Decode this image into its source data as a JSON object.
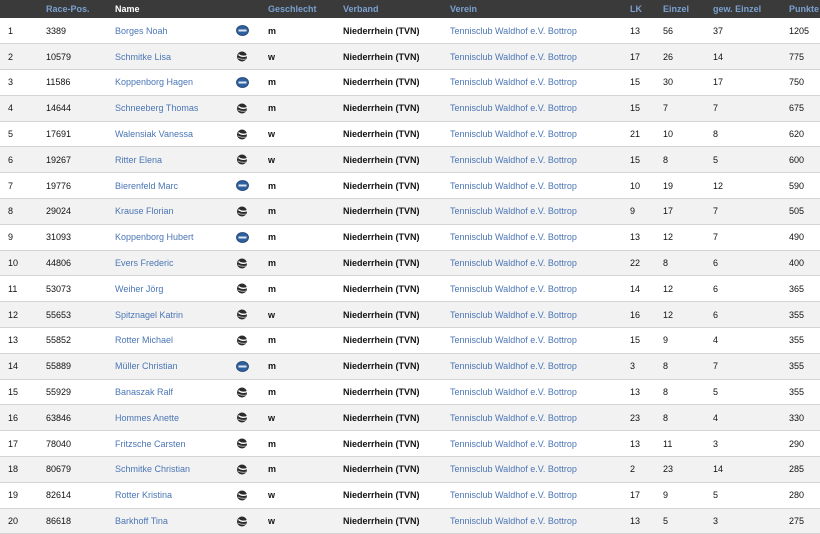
{
  "headers": {
    "no": "",
    "race_pos": "Race-Pos.",
    "name": "Name",
    "icon": "",
    "geschlecht": "Geschlecht",
    "verband": "Verband",
    "verein": "Verein",
    "lk": "LK",
    "einzel": "Einzel",
    "gew_einzel": "gew. Einzel",
    "punkte": "Punkte"
  },
  "rows": [
    {
      "no": "1",
      "race": "3389",
      "name": "Borges Noah",
      "icon": "badge-icon",
      "sex": "m",
      "verband": "Niederrhein (TVN)",
      "verein": "Tennisclub Waldhof e.V. Bottrop",
      "lk": "13",
      "einzel": "56",
      "gew": "37",
      "punkte": "1205"
    },
    {
      "no": "2",
      "race": "10579",
      "name": "Schmitke Lisa",
      "icon": "ball-icon",
      "sex": "w",
      "verband": "Niederrhein (TVN)",
      "verein": "Tennisclub Waldhof e.V. Bottrop",
      "lk": "17",
      "einzel": "26",
      "gew": "14",
      "punkte": "775"
    },
    {
      "no": "3",
      "race": "11586",
      "name": "Koppenborg Hagen",
      "icon": "badge-icon",
      "sex": "m",
      "verband": "Niederrhein (TVN)",
      "verein": "Tennisclub Waldhof e.V. Bottrop",
      "lk": "15",
      "einzel": "30",
      "gew": "17",
      "punkte": "750"
    },
    {
      "no": "4",
      "race": "14644",
      "name": "Schneeberg Thomas",
      "icon": "ball-icon",
      "sex": "m",
      "verband": "Niederrhein (TVN)",
      "verein": "Tennisclub Waldhof e.V. Bottrop",
      "lk": "15",
      "einzel": "7",
      "gew": "7",
      "punkte": "675"
    },
    {
      "no": "5",
      "race": "17691",
      "name": "Walensiak Vanessa",
      "icon": "ball-icon",
      "sex": "w",
      "verband": "Niederrhein (TVN)",
      "verein": "Tennisclub Waldhof e.V. Bottrop",
      "lk": "21",
      "einzel": "10",
      "gew": "8",
      "punkte": "620"
    },
    {
      "no": "6",
      "race": "19267",
      "name": "Ritter Elena",
      "icon": "ball-icon",
      "sex": "w",
      "verband": "Niederrhein (TVN)",
      "verein": "Tennisclub Waldhof e.V. Bottrop",
      "lk": "15",
      "einzel": "8",
      "gew": "5",
      "punkte": "600"
    },
    {
      "no": "7",
      "race": "19776",
      "name": "Bierenfeld Marc",
      "icon": "badge-icon",
      "sex": "m",
      "verband": "Niederrhein (TVN)",
      "verein": "Tennisclub Waldhof e.V. Bottrop",
      "lk": "10",
      "einzel": "19",
      "gew": "12",
      "punkte": "590"
    },
    {
      "no": "8",
      "race": "29024",
      "name": "Krause Florian",
      "icon": "ball-icon",
      "sex": "m",
      "verband": "Niederrhein (TVN)",
      "verein": "Tennisclub Waldhof e.V. Bottrop",
      "lk": "9",
      "einzel": "17",
      "gew": "7",
      "punkte": "505"
    },
    {
      "no": "9",
      "race": "31093",
      "name": "Koppenborg Hubert",
      "icon": "badge-icon",
      "sex": "m",
      "verband": "Niederrhein (TVN)",
      "verein": "Tennisclub Waldhof e.V. Bottrop",
      "lk": "13",
      "einzel": "12",
      "gew": "7",
      "punkte": "490"
    },
    {
      "no": "10",
      "race": "44806",
      "name": "Evers Frederic",
      "icon": "ball-icon",
      "sex": "m",
      "verband": "Niederrhein (TVN)",
      "verein": "Tennisclub Waldhof e.V. Bottrop",
      "lk": "22",
      "einzel": "8",
      "gew": "6",
      "punkte": "400"
    },
    {
      "no": "11",
      "race": "53073",
      "name": "Weiher Jörg",
      "icon": "ball-icon",
      "sex": "m",
      "verband": "Niederrhein (TVN)",
      "verein": "Tennisclub Waldhof e.V. Bottrop",
      "lk": "14",
      "einzel": "12",
      "gew": "6",
      "punkte": "365"
    },
    {
      "no": "12",
      "race": "55653",
      "name": "Spitznagel Katrin",
      "icon": "ball-icon",
      "sex": "w",
      "verband": "Niederrhein (TVN)",
      "verein": "Tennisclub Waldhof e.V. Bottrop",
      "lk": "16",
      "einzel": "12",
      "gew": "6",
      "punkte": "355"
    },
    {
      "no": "13",
      "race": "55852",
      "name": "Rotter Michael",
      "icon": "ball-icon",
      "sex": "m",
      "verband": "Niederrhein (TVN)",
      "verein": "Tennisclub Waldhof e.V. Bottrop",
      "lk": "15",
      "einzel": "9",
      "gew": "4",
      "punkte": "355"
    },
    {
      "no": "14",
      "race": "55889",
      "name": "Müller Christian",
      "icon": "badge-icon",
      "sex": "m",
      "verband": "Niederrhein (TVN)",
      "verein": "Tennisclub Waldhof e.V. Bottrop",
      "lk": "3",
      "einzel": "8",
      "gew": "7",
      "punkte": "355"
    },
    {
      "no": "15",
      "race": "55929",
      "name": "Banaszak Ralf",
      "icon": "ball-icon",
      "sex": "m",
      "verband": "Niederrhein (TVN)",
      "verein": "Tennisclub Waldhof e.V. Bottrop",
      "lk": "13",
      "einzel": "8",
      "gew": "5",
      "punkte": "355"
    },
    {
      "no": "16",
      "race": "63846",
      "name": "Hommes Anette",
      "icon": "ball-icon",
      "sex": "w",
      "verband": "Niederrhein (TVN)",
      "verein": "Tennisclub Waldhof e.V. Bottrop",
      "lk": "23",
      "einzel": "8",
      "gew": "4",
      "punkte": "330"
    },
    {
      "no": "17",
      "race": "78040",
      "name": "Fritzsche Carsten",
      "icon": "ball-icon",
      "sex": "m",
      "verband": "Niederrhein (TVN)",
      "verein": "Tennisclub Waldhof e.V. Bottrop",
      "lk": "13",
      "einzel": "11",
      "gew": "3",
      "punkte": "290"
    },
    {
      "no": "18",
      "race": "80679",
      "name": "Schmitke Christian",
      "icon": "ball-icon",
      "sex": "m",
      "verband": "Niederrhein (TVN)",
      "verein": "Tennisclub Waldhof e.V. Bottrop",
      "lk": "2",
      "einzel": "23",
      "gew": "14",
      "punkte": "285"
    },
    {
      "no": "19",
      "race": "82614",
      "name": "Rotter Kristina",
      "icon": "ball-icon",
      "sex": "w",
      "verband": "Niederrhein (TVN)",
      "verein": "Tennisclub Waldhof e.V. Bottrop",
      "lk": "17",
      "einzel": "9",
      "gew": "5",
      "punkte": "280"
    },
    {
      "no": "20",
      "race": "86618",
      "name": "Barkhoff Tina",
      "icon": "ball-icon",
      "sex": "w",
      "verband": "Niederrhein (TVN)",
      "verein": "Tennisclub Waldhof e.V. Bottrop",
      "lk": "13",
      "einzel": "5",
      "gew": "3",
      "punkte": "275"
    }
  ],
  "colors": {
    "header_bg": "#3a3a3a",
    "header_text": "#7aa0cf",
    "link": "#4b76b5",
    "row_alt": "#f2f2f2",
    "badge": "#2e5f9e"
  }
}
